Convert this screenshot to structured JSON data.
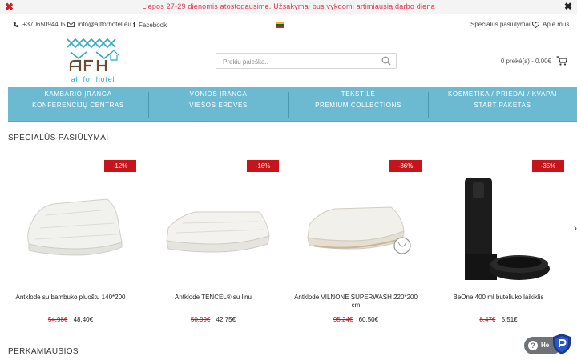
{
  "notice": {
    "text": "Liepos 27-29 dienomis atostogausime. Užsakymai bus vykdomi artimiausią darbo dieną",
    "close_left_icon": "✖",
    "close_right_icon": "✖"
  },
  "topbar": {
    "phone": "+37065094405",
    "email": "info@allforhotel.eu",
    "facebook": "Facebook",
    "special_offers": "Specialūs pasiūlymai",
    "about": "Apie mus"
  },
  "logo": {
    "text": "all for hotel",
    "brand_color": "#2aa9c5",
    "accent_color": "#6b4b2f"
  },
  "search": {
    "placeholder": "Prekių paieška.."
  },
  "cart": {
    "summary": "0 prekė(s) - 0.00€"
  },
  "nav": {
    "color": "#6bbad1",
    "items": [
      "Kambario įranga",
      "Vonios įranga",
      "Tekstilė",
      "Kosmetika / priedai / kvapai",
      "Konferencijų centras",
      "Viešos erdvės",
      "Premium Collections",
      "Start paketas"
    ]
  },
  "sections": {
    "special": "Specialūs pasiūlymai",
    "bestsellers": "Perkamiausios"
  },
  "products": [
    {
      "name": "Antklode su bambuko pluoštu 140*200",
      "old_price": "54.98€",
      "new_price": "48.40€",
      "discount": "-12%"
    },
    {
      "name": "Antklode TENCEL® su linu",
      "old_price": "50.99€",
      "new_price": "42.75€",
      "discount": "-16%"
    },
    {
      "name": "Antklode VILNONE SUPERWASH 220*200 cm",
      "old_price": "95.24€",
      "new_price": "60.50€",
      "discount": "-36%"
    },
    {
      "name": "BeOne 400 ml buteliuko laikiklis",
      "old_price": "8.47€",
      "new_price": "5.51€",
      "discount": "-35%"
    }
  ],
  "help": {
    "label": "He"
  },
  "badge_color": "#c6141a"
}
